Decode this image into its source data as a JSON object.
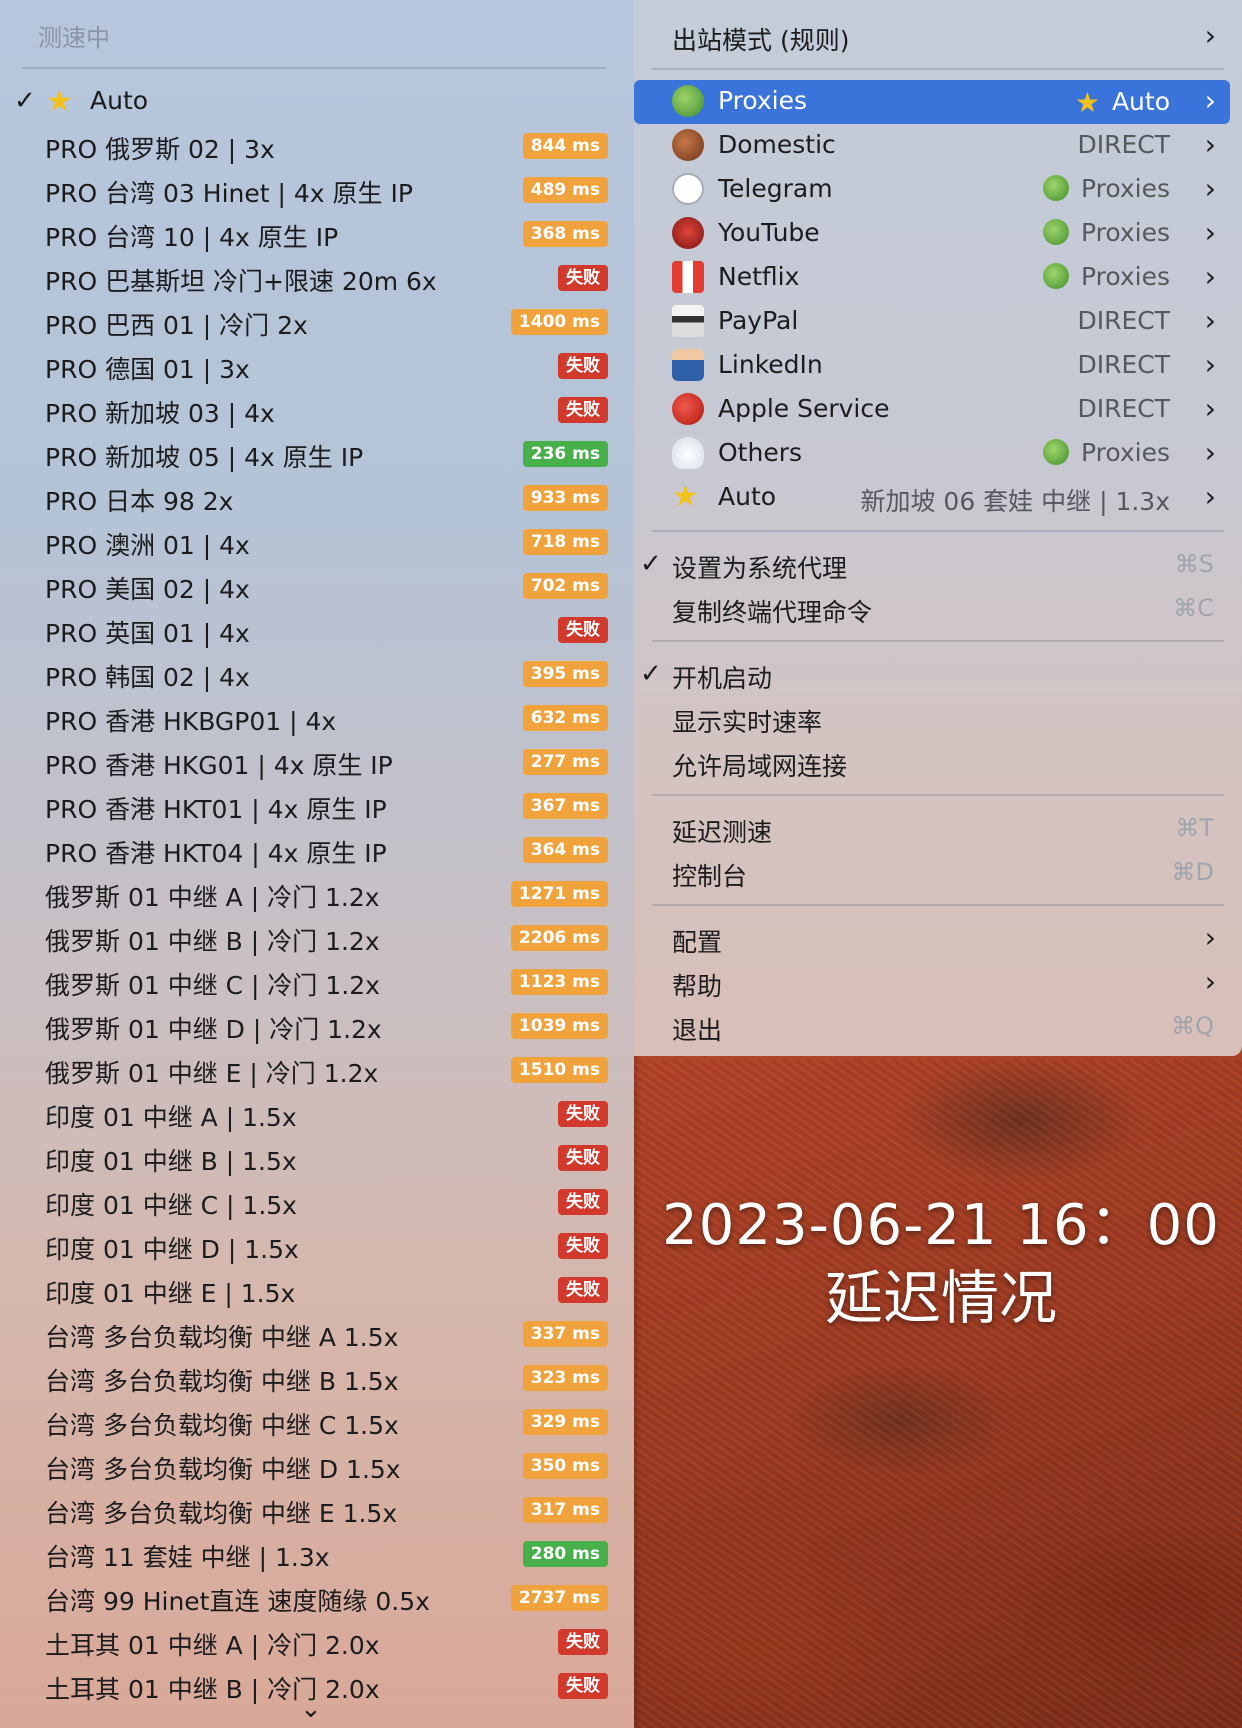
{
  "proxy_menu": {
    "header": "测速中",
    "scroll_indicator": "⌄",
    "items": [
      {
        "name": "Auto",
        "checked": true,
        "star": true
      },
      {
        "name": "PRO 俄罗斯 02 | 3x",
        "latency": "844 ms",
        "status": "orange"
      },
      {
        "name": "PRO 台湾 03 Hinet | 4x 原生 IP",
        "latency": "489 ms",
        "status": "orange"
      },
      {
        "name": "PRO 台湾 10 | 4x 原生 IP",
        "latency": "368 ms",
        "status": "orange"
      },
      {
        "name": "PRO 巴基斯坦 冷门+限速 20m 6x",
        "latency": "失败",
        "status": "red"
      },
      {
        "name": "PRO 巴西 01 | 冷门 2x",
        "latency": "1400 ms",
        "status": "orange"
      },
      {
        "name": "PRO 德国 01 | 3x",
        "latency": "失败",
        "status": "red"
      },
      {
        "name": "PRO 新加坡 03 | 4x",
        "latency": "失败",
        "status": "red"
      },
      {
        "name": "PRO 新加坡 05 | 4x 原生 IP",
        "latency": "236 ms",
        "status": "green"
      },
      {
        "name": "PRO 日本 98 2x",
        "latency": "933 ms",
        "status": "orange"
      },
      {
        "name": "PRO 澳洲 01 | 4x",
        "latency": "718 ms",
        "status": "orange"
      },
      {
        "name": "PRO 美国 02 | 4x",
        "latency": "702 ms",
        "status": "orange"
      },
      {
        "name": "PRO 英国 01 | 4x",
        "latency": "失败",
        "status": "red"
      },
      {
        "name": "PRO 韩国 02 | 4x",
        "latency": "395 ms",
        "status": "orange"
      },
      {
        "name": "PRO 香港 HKBGP01 | 4x",
        "latency": "632 ms",
        "status": "orange"
      },
      {
        "name": "PRO 香港 HKG01 | 4x 原生 IP",
        "latency": "277 ms",
        "status": "orange"
      },
      {
        "name": "PRO 香港 HKT01 | 4x 原生 IP",
        "latency": "367 ms",
        "status": "orange"
      },
      {
        "name": "PRO 香港 HKT04 | 4x 原生 IP",
        "latency": "364 ms",
        "status": "orange"
      },
      {
        "name": "俄罗斯 01 中继 A | 冷门 1.2x",
        "latency": "1271 ms",
        "status": "orange"
      },
      {
        "name": "俄罗斯 01 中继 B | 冷门 1.2x",
        "latency": "2206 ms",
        "status": "orange"
      },
      {
        "name": "俄罗斯 01 中继 C | 冷门 1.2x",
        "latency": "1123 ms",
        "status": "orange"
      },
      {
        "name": "俄罗斯 01 中继 D | 冷门 1.2x",
        "latency": "1039 ms",
        "status": "orange"
      },
      {
        "name": "俄罗斯 01 中继 E | 冷门 1.2x",
        "latency": "1510 ms",
        "status": "orange"
      },
      {
        "name": "印度 01 中继 A | 1.5x",
        "latency": "失败",
        "status": "red"
      },
      {
        "name": "印度 01 中继 B | 1.5x",
        "latency": "失败",
        "status": "red"
      },
      {
        "name": "印度 01 中继 C | 1.5x",
        "latency": "失败",
        "status": "red"
      },
      {
        "name": "印度 01 中继 D | 1.5x",
        "latency": "失败",
        "status": "red"
      },
      {
        "name": "印度 01 中继 E | 1.5x",
        "latency": "失败",
        "status": "red"
      },
      {
        "name": "台湾 多台负载均衡 中继 A 1.5x",
        "latency": "337 ms",
        "status": "orange"
      },
      {
        "name": "台湾 多台负载均衡 中继 B 1.5x",
        "latency": "323 ms",
        "status": "orange"
      },
      {
        "name": "台湾 多台负载均衡 中继 C 1.5x",
        "latency": "329 ms",
        "status": "orange"
      },
      {
        "name": "台湾 多台负载均衡 中继 D 1.5x",
        "latency": "350 ms",
        "status": "orange"
      },
      {
        "name": "台湾 多台负载均衡 中继 E 1.5x",
        "latency": "317 ms",
        "status": "orange"
      },
      {
        "name": "台湾 11 套娃 中继 | 1.3x",
        "latency": "280 ms",
        "status": "green"
      },
      {
        "name": "台湾 99 Hinet直连 速度随缘 0.5x",
        "latency": "2737 ms",
        "status": "orange"
      },
      {
        "name": "土耳其 01 中继 A | 冷门 2.0x",
        "latency": "失败",
        "status": "red"
      },
      {
        "name": "土耳其 01 中继 B | 冷门 2.0x",
        "latency": "失败",
        "status": "red"
      }
    ]
  },
  "main_menu": {
    "outbound_mode": "出站模式 (规则)",
    "groups": [
      {
        "label": "Proxies",
        "icon": "leaf-icon",
        "value": "Auto",
        "value_icon": "star-icon",
        "selected": true
      },
      {
        "label": "Domestic",
        "icon": "leaves-icon",
        "value": "DIRECT"
      },
      {
        "label": "Telegram",
        "icon": "speech-bubble-icon",
        "value": "Proxies",
        "value_icon": "leaf-icon"
      },
      {
        "label": "YouTube",
        "icon": "ogre-mask-icon",
        "value": "Proxies",
        "value_icon": "leaf-icon"
      },
      {
        "label": "Netflix",
        "icon": "popcorn-icon",
        "value": "Proxies",
        "value_icon": "leaf-icon"
      },
      {
        "label": "PayPal",
        "icon": "credit-card-icon",
        "value": "DIRECT"
      },
      {
        "label": "LinkedIn",
        "icon": "businessman-icon",
        "value": "DIRECT"
      },
      {
        "label": "Apple Service",
        "icon": "apple-icon",
        "value": "DIRECT"
      },
      {
        "label": "Others",
        "icon": "cloud-icon",
        "value": "Proxies",
        "value_icon": "leaf-icon"
      },
      {
        "label": "Auto",
        "icon": "star-icon",
        "value": "新加坡 06 套娃 中继 | 1.3x"
      }
    ],
    "system_items": [
      {
        "label": "设置为系统代理",
        "checked": true,
        "shortcut": "⌘S"
      },
      {
        "label": "复制终端代理命令",
        "shortcut": "⌘C"
      }
    ],
    "startup_items": [
      {
        "label": "开机启动",
        "checked": true
      },
      {
        "label": "显示实时速率"
      },
      {
        "label": "允许局域网连接"
      }
    ],
    "tool_items": [
      {
        "label": "延迟测速",
        "shortcut": "⌘T"
      },
      {
        "label": "控制台",
        "shortcut": "⌘D"
      }
    ],
    "config_items": [
      {
        "label": "配置",
        "submenu": true
      },
      {
        "label": "帮助",
        "submenu": true
      },
      {
        "label": "退出",
        "shortcut": "⌘Q"
      }
    ]
  },
  "overlay": {
    "date_time": "2023-06-21  16：00",
    "caption": "延迟情况"
  },
  "colors": {
    "orange": "#f0a23c",
    "red": "#d0392c",
    "green": "#47b04a",
    "selected": "#3a74da"
  }
}
